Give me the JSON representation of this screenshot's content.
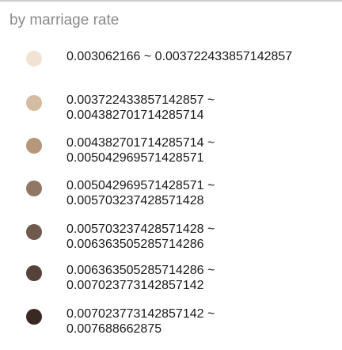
{
  "legend": {
    "title": "by marriage rate",
    "items": [
      {
        "line1": "0.003062166 ~ 0.003722433857142857",
        "line2": "",
        "color": "#f1e3d3"
      },
      {
        "line1": "0.003722433857142857 ~",
        "line2": "0.004382701714285714",
        "color": "#d5bba2"
      },
      {
        "line1": "0.004382701714285714 ~",
        "line2": "0.005042969571428571",
        "color": "#b4977d"
      },
      {
        "line1": "0.005042969571428571 ~",
        "line2": "0.005703237428571428",
        "color": "#907766"
      },
      {
        "line1": "0.005703237428571428 ~",
        "line2": "0.006363505285714286",
        "color": "#6f5a4d"
      },
      {
        "line1": "0.006363505285714286 ~",
        "line2": "0.007023773142857142",
        "color": "#554239"
      },
      {
        "line1": "0.007023773142857142 ~",
        "line2": "0.007688662875",
        "color": "#3a2823"
      }
    ]
  }
}
